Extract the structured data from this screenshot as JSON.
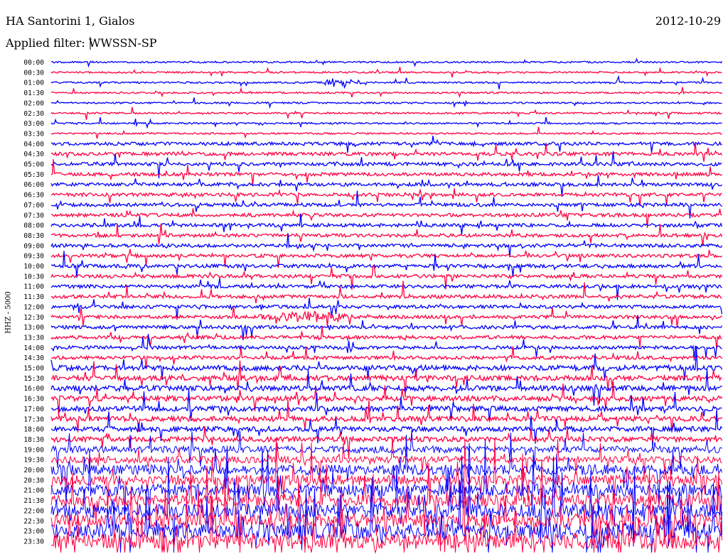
{
  "header": {
    "station": "HA Santorini 1, Gialos",
    "date": "2012-10-29",
    "filter_label": "Applied filter: WWSSN-SP"
  },
  "channel_label": "HHZ - 5000",
  "chart_data": {
    "type": "line",
    "title": "HA Santorini 1, Gialos",
    "subtitle": "Applied filter: WWSSN-SP",
    "date": "2012-10-29",
    "ylabel": "HHZ - 5000",
    "grid": false,
    "colors": {
      "even_rows": "#0000ff",
      "odd_rows": "#ff0040"
    },
    "time_labels": [
      "00:00",
      "00:30",
      "01:00",
      "01:30",
      "02:00",
      "02:30",
      "03:00",
      "03:30",
      "04:00",
      "04:30",
      "05:00",
      "05:30",
      "06:00",
      "06:30",
      "07:00",
      "07:30",
      "08:00",
      "08:30",
      "09:00",
      "09:30",
      "10:00",
      "10:30",
      "11:00",
      "11:30",
      "12:00",
      "12:30",
      "13:00",
      "13:30",
      "14:00",
      "14:30",
      "15:00",
      "15:30",
      "16:00",
      "16:30",
      "17:00",
      "17:30",
      "18:00",
      "18:30",
      "19:00",
      "19:30",
      "20:00",
      "20:30",
      "21:00",
      "21:30",
      "22:00",
      "22:30",
      "23:00",
      "23:30"
    ],
    "background_amplitude": [
      1,
      1,
      1,
      1,
      1,
      1,
      1,
      1,
      2,
      2,
      2,
      2,
      2,
      2,
      2,
      2,
      2,
      2,
      2,
      2,
      2,
      2,
      2,
      2,
      2,
      2,
      2,
      2,
      2,
      2,
      3,
      3,
      3,
      3,
      3,
      3,
      3,
      3,
      4,
      4,
      6,
      6,
      7,
      7,
      8,
      8,
      9,
      9
    ],
    "events": [
      {
        "time": "01:00",
        "note": ""
      },
      {
        "time": "12:30",
        "note": ""
      }
    ]
  }
}
